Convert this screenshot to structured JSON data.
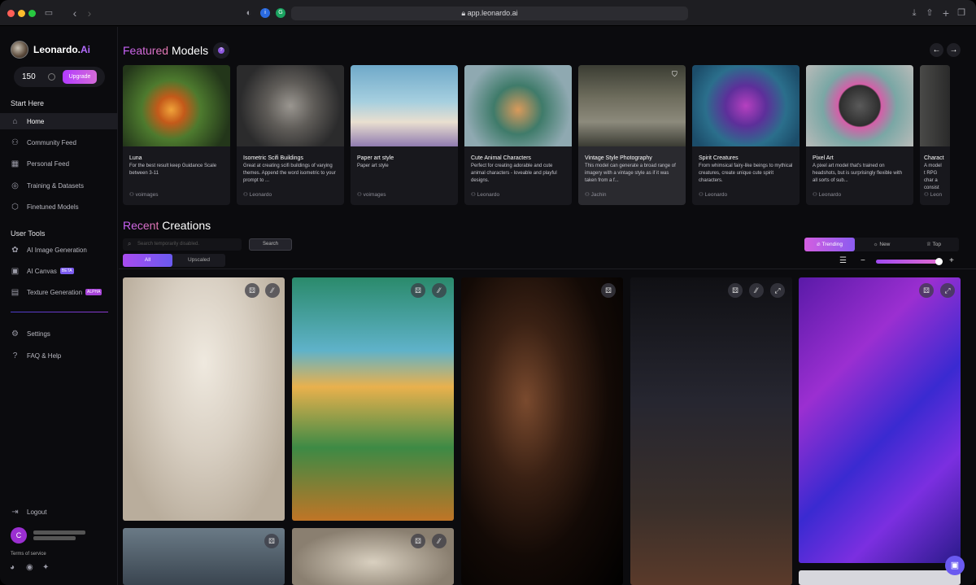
{
  "browser": {
    "url": "app.leonardo.ai"
  },
  "sidebar": {
    "brand": "Leonardo.",
    "brand_accent": "Ai",
    "credits": "150",
    "upgrade_label": "Upgrade",
    "start_here": "Start Here",
    "items": [
      {
        "label": "Home",
        "icon": "home-icon"
      },
      {
        "label": "Community Feed",
        "icon": "community-icon"
      },
      {
        "label": "Personal Feed",
        "icon": "grid-icon"
      },
      {
        "label": "Training & Datasets",
        "icon": "training-icon"
      },
      {
        "label": "Finetuned Models",
        "icon": "cube-icon"
      }
    ],
    "user_tools": "User Tools",
    "tools": [
      {
        "label": "AI Image Generation",
        "icon": "image-gen-icon"
      },
      {
        "label": "AI Canvas",
        "icon": "canvas-icon",
        "badge": "BETA"
      },
      {
        "label": "Texture Generation",
        "icon": "texture-icon",
        "badge": "ALPHA"
      }
    ],
    "bottom": [
      {
        "label": "Settings",
        "icon": "gear-icon"
      },
      {
        "label": "FAQ & Help",
        "icon": "help-icon"
      }
    ],
    "logout": "Logout",
    "user_initial": "C",
    "terms": "Terms of service"
  },
  "featured": {
    "title_accent": "Featured",
    "title_rest": "Models",
    "cards": [
      {
        "title": "Luna",
        "desc": "For the best result keep Guidance Scale between 3-11",
        "author": "voimages"
      },
      {
        "title": "Isometric Scifi Buildings",
        "desc": "Great at creating scifi buildings of varying themes. Append the word isometric to your prompt to ...",
        "author": "Leonardo"
      },
      {
        "title": "Paper art style",
        "desc": "Paper art style",
        "author": "voimages"
      },
      {
        "title": "Cute Animal Characters",
        "desc": "Perfect for creating adorable and cute animal characters - loveable and playful designs.",
        "author": "Leonardo"
      },
      {
        "title": "Vintage Style Photography",
        "desc": "This model can generate a broad range of imagery with a vintage style as if it was taken from a f...",
        "author": "Jachin"
      },
      {
        "title": "Spirit Creatures",
        "desc": "From whimsical fairy-like beings to mythical creatures, create unique cute spirit characters.",
        "author": "Leonardo"
      },
      {
        "title": "Pixel Art",
        "desc": "A pixel art model that's trained on headshots, but is surprisingly flexible with all sorts of sub...",
        "author": "Leonardo"
      },
      {
        "title": "Charact",
        "desc": "A model t RPG char a consist",
        "author": "Leon"
      }
    ]
  },
  "recent": {
    "title_accent": "Recent",
    "title_rest": "Creations",
    "search_placeholder": "Search temporarily disabled.",
    "search_button": "Search",
    "filter_all": "All",
    "filter_upscaled": "Upscaled",
    "sort_trending": "Trending",
    "sort_new": "New",
    "sort_top": "Top"
  },
  "colors": {
    "accent": "#b33bff",
    "accent2": "#6a5af0"
  }
}
